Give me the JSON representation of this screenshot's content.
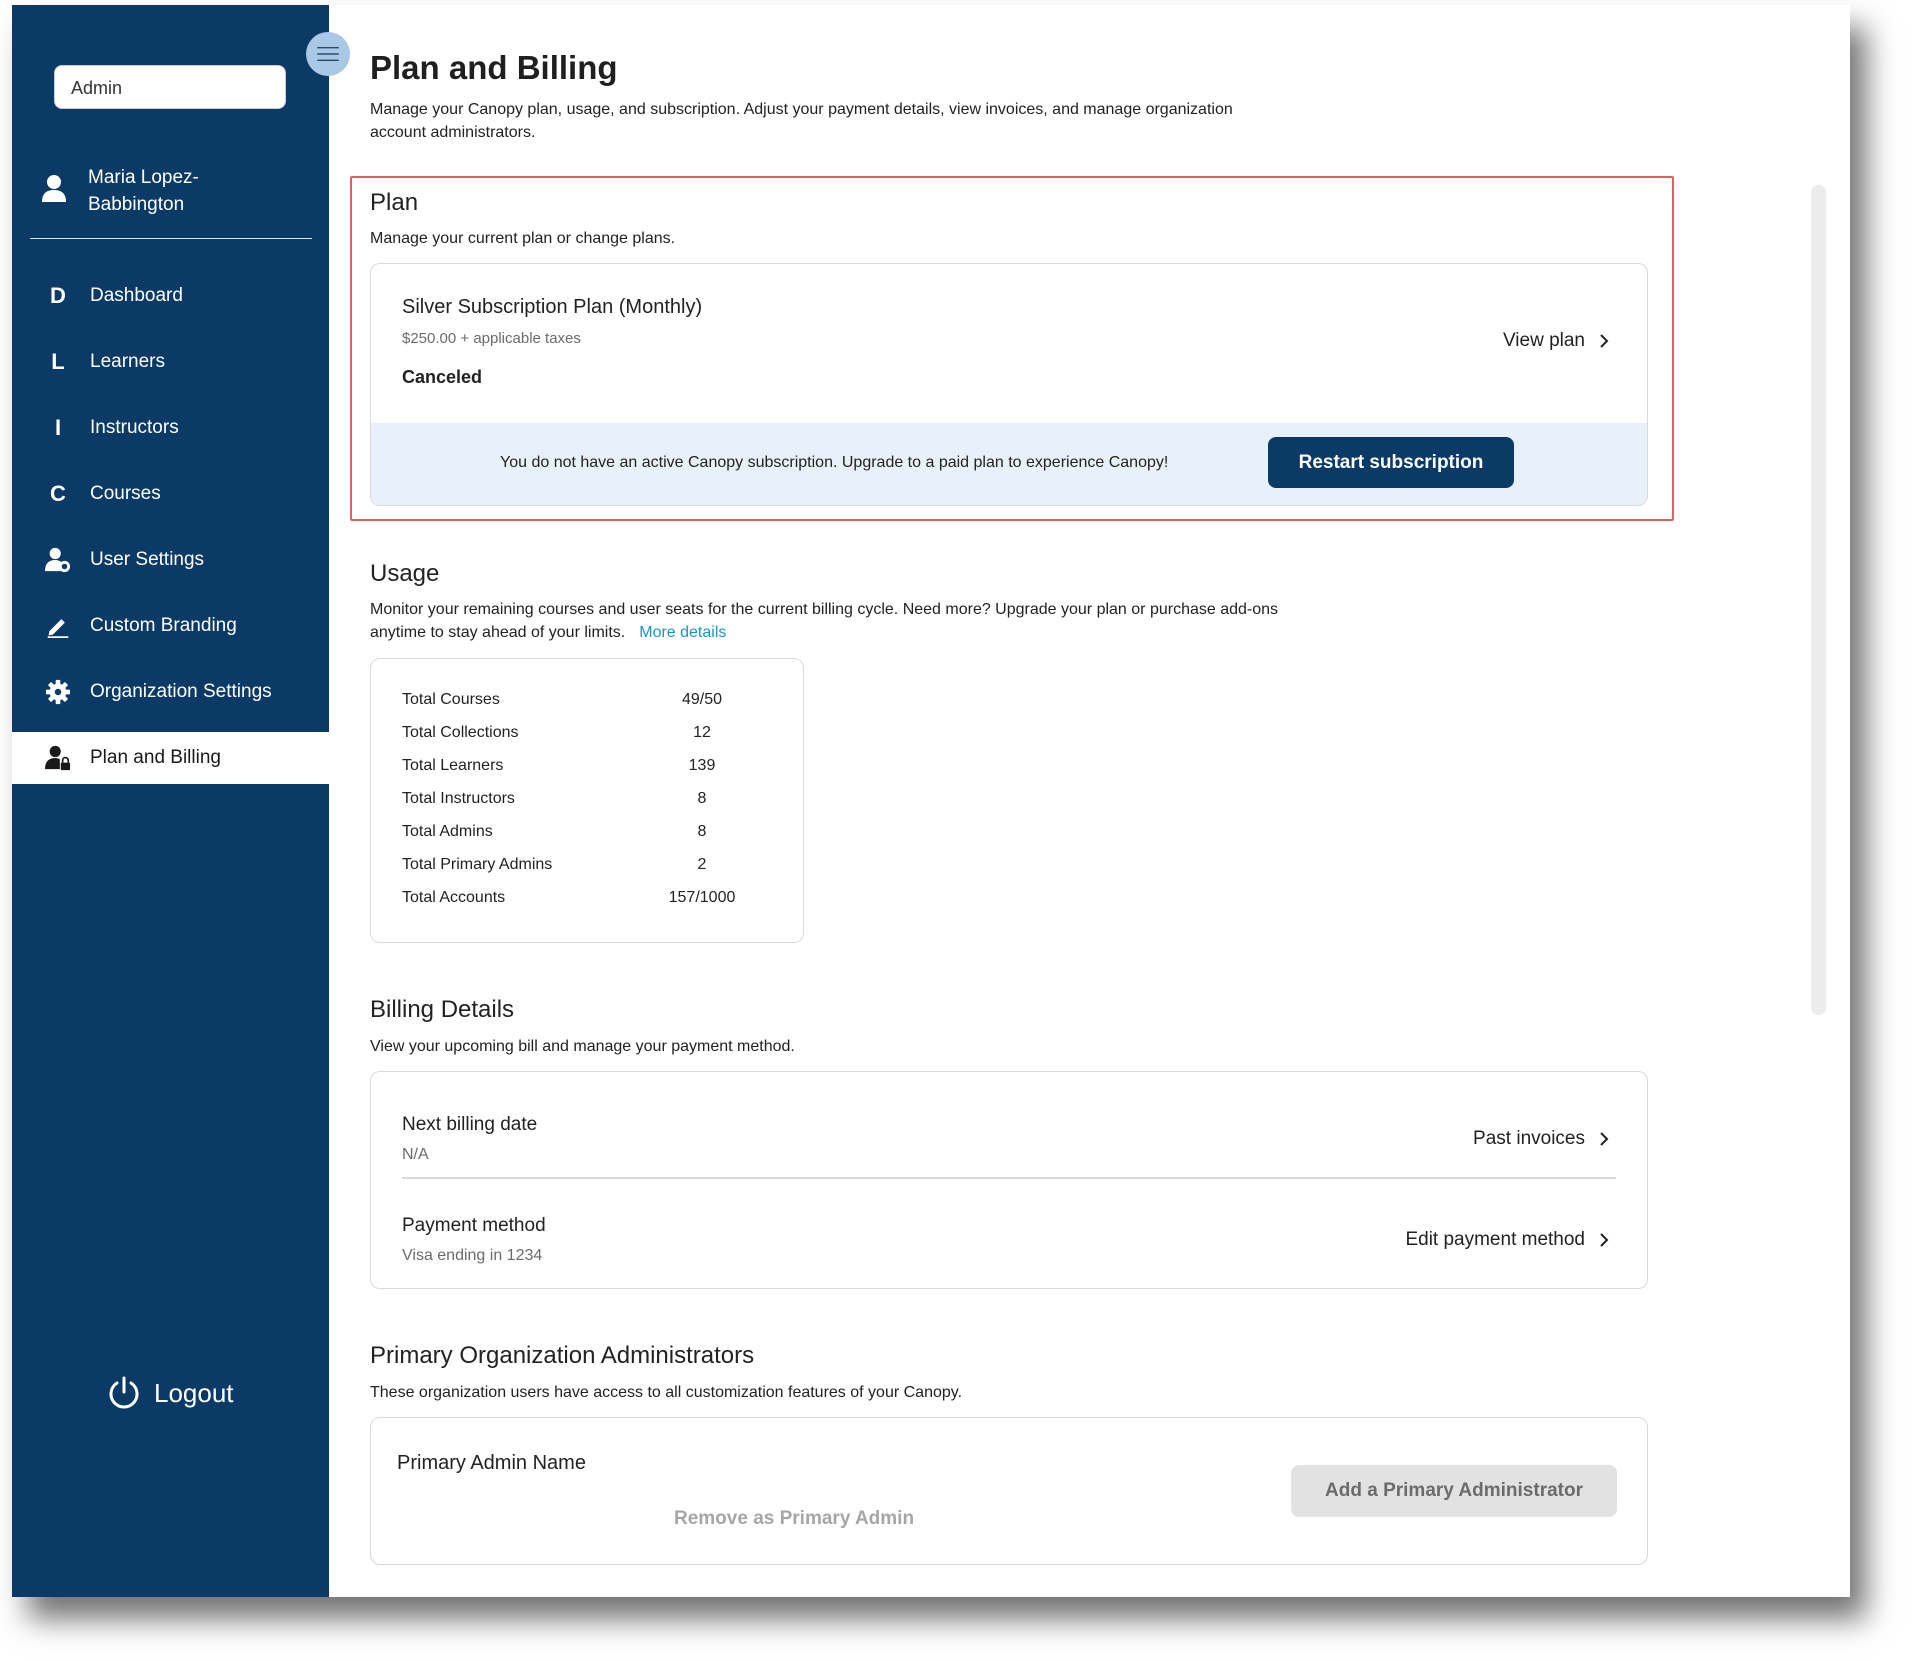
{
  "sidebar": {
    "role": "Admin",
    "user_name": "Maria Lopez-Babbington",
    "items": [
      {
        "label": "Dashboard",
        "icon": "D"
      },
      {
        "label": "Learners",
        "icon": "L"
      },
      {
        "label": "Instructors",
        "icon": "I"
      },
      {
        "label": "Courses",
        "icon": "C"
      },
      {
        "label": "User Settings",
        "icon": "user-gear-icon"
      },
      {
        "label": "Custom Branding",
        "icon": "pencil-icon"
      },
      {
        "label": "Organization Settings",
        "icon": "gear-icon"
      },
      {
        "label": "Plan and Billing",
        "icon": "user-lock-icon",
        "active": true
      }
    ],
    "logout": "Logout"
  },
  "page": {
    "title": "Plan and Billing",
    "description": "Manage your Canopy plan, usage, and subscription. Adjust your payment details, view invoices, and manage organization account administrators."
  },
  "plan": {
    "title": "Plan",
    "description": "Manage your current plan or change plans.",
    "name": "Silver Subscription Plan (Monthly)",
    "price": "$250.00 + applicable taxes",
    "status": "Canceled",
    "view_link": "View plan",
    "banner_text": "You do not have an active Canopy subscription. Upgrade to a paid plan to experience Canopy!",
    "restart_button": "Restart subscription"
  },
  "usage": {
    "title": "Usage",
    "description": "Monitor your remaining courses and user seats for the current billing cycle. Need more? Upgrade your plan or purchase add-ons anytime to stay ahead of your limits.",
    "more_link": "More details",
    "rows": [
      {
        "label": "Total Courses",
        "value": "49/50"
      },
      {
        "label": "Total Collections",
        "value": "12"
      },
      {
        "label": "Total Learners",
        "value": "139"
      },
      {
        "label": "Total Instructors",
        "value": "8"
      },
      {
        "label": "Total Admins",
        "value": "8"
      },
      {
        "label": "Total Primary Admins",
        "value": "2"
      },
      {
        "label": "Total Accounts",
        "value": "157/1000"
      }
    ]
  },
  "billing": {
    "title": "Billing Details",
    "description": "View your upcoming bill and manage your payment method.",
    "next_date_label": "Next billing date",
    "next_date_value": "N/A",
    "past_invoices": "Past invoices",
    "payment_label": "Payment method",
    "payment_value": "Visa ending in 1234",
    "edit_payment": "Edit payment method"
  },
  "admins": {
    "title": "Primary Organization Administrators",
    "description": "These organization users have access to all customization features of your Canopy.",
    "header": "Primary Admin Name",
    "remove": "Remove as Primary Admin",
    "add_button": "Add a Primary Administrator"
  },
  "colors": {
    "sidebar_bg": "#0b3a66",
    "primary_button": "#0b3a66",
    "banner_bg": "#e8f1fa",
    "highlight_border": "#e06060",
    "link": "#1a96c4"
  }
}
